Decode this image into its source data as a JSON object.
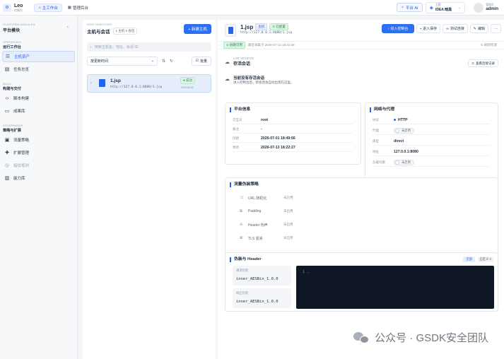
{
  "app": {
    "name": "Leo",
    "subtitle": "控制台"
  },
  "top_tabs": [
    {
      "label": "主工作台",
      "active": true
    },
    {
      "label": "管理后台",
      "active": false
    }
  ],
  "top_right": {
    "ai_button": "平台 AI",
    "theme_label": "主题",
    "theme_value": "IDEA 暗黑",
    "user_role": "管理员",
    "user_name": "admin"
  },
  "sidebar": {
    "module_kicker": "PLATFORM MODULES",
    "module_title": "平台模块",
    "groups": [
      {
        "kicker": "OPERATIONS",
        "title": "运行工作台",
        "items": [
          {
            "label": "主机资产",
            "icon": "server-icon",
            "active": true,
            "muted": false
          },
          {
            "label": "任务总览",
            "icon": "list-icon",
            "active": false,
            "muted": false
          }
        ]
      },
      {
        "kicker": "BUILD",
        "title": "构建与交付",
        "items": [
          {
            "label": "脚本构建",
            "icon": "code-icon",
            "active": false,
            "muted": false
          },
          {
            "label": "成果库",
            "icon": "folder-icon",
            "active": false,
            "muted": false
          }
        ]
      },
      {
        "kicker": "GOVERNANCE",
        "title": "策略与扩展",
        "items": [
          {
            "label": "流量策略",
            "icon": "traffic-icon",
            "active": false,
            "muted": false
          },
          {
            "label": "扩展管理",
            "icon": "puzzle-icon",
            "active": false,
            "muted": false
          },
          {
            "label": "指纹规则",
            "icon": "fingerprint-icon",
            "active": false,
            "muted": true
          },
          {
            "label": "能力库",
            "icon": "library-icon",
            "active": false,
            "muted": false
          }
        ]
      }
    ]
  },
  "host_list": {
    "kicker": "HOST DIRECTORY",
    "title": "主机与会话",
    "count_hosts": "1 主机",
    "count_sessions": "0 会话",
    "new_button": "+ 新建主机",
    "search_placeholder": "搜索主机名、地址、会话 ID",
    "sort_value": "按更新时间",
    "batch_button": "批量",
    "hosts": [
      {
        "name": "1.jsp",
        "url": "http://127.0.0.1:8080/1.jsp",
        "status": "成功",
        "mode": "BEHINDE"
      }
    ]
  },
  "detail": {
    "title": "1.jsp",
    "tag_host": "主机",
    "tag_configured": "已配置",
    "url": "http://127.0.0.1:8080/1.jsp",
    "actions": {
      "enter": "进入控制台",
      "save": "进入保存",
      "test": "测试连接",
      "edit": "编辑",
      "more": "···"
    },
    "state_tag": "链路可用",
    "state_text": "最近采集于 2026-07-13 18:22:26",
    "refresh": "刷新检测",
    "session_kicker": "LIVE SESSION",
    "session_title": "存活会话",
    "view_records": "查看连接记录",
    "notice_title": "当前没有存活会话",
    "notice_desc": "进入控制台后，新会话会自动出现在这里。",
    "platform_info": {
      "title": "平台信息",
      "rows": [
        {
          "k": "交互员",
          "v": "root"
        },
        {
          "k": "备注",
          "v": "-"
        },
        {
          "k": "创建",
          "v": "2026-07-01 18:49:56"
        },
        {
          "k": "更新",
          "v": "2026-07-13 18:22:27"
        }
      ]
    },
    "network": {
      "title": "网络与代理",
      "protocol_k": "协议",
      "protocol_v": "HTTP",
      "proxy_k": "代理",
      "proxy_v": "未启用",
      "type_k": "类型",
      "type_v": "direct",
      "addr_k": "地址",
      "addr_v": "127.0.0.1:8080",
      "lb_k": "负载均衡",
      "lb_v": "未启用"
    },
    "traffic": {
      "title": "流量伪装策略",
      "rows": [
        {
          "icon": "shuffle-icon",
          "k": "URL 随机化",
          "v": "未启用"
        },
        {
          "icon": "padding-icon",
          "k": "Padding",
          "v": "未启用"
        },
        {
          "icon": "header-icon",
          "k": "Header 伪声",
          "v": "未启用"
        },
        {
          "icon": "tls-icon",
          "k": "TLS 混淆",
          "v": "未启用"
        }
      ]
    },
    "header_section": {
      "title": "伪装与 Header",
      "badge_all": "全部",
      "badge_custom": "自定义 0",
      "req_k": "请求伪装",
      "req_v": "inner_AESBin_1.0.0",
      "resp_k": "响应伪装",
      "resp_v": "inner_AESBin_1.0.0",
      "editor_line": "1 ⌄"
    }
  },
  "watermark": "公众号 · GSDK安全团队"
}
